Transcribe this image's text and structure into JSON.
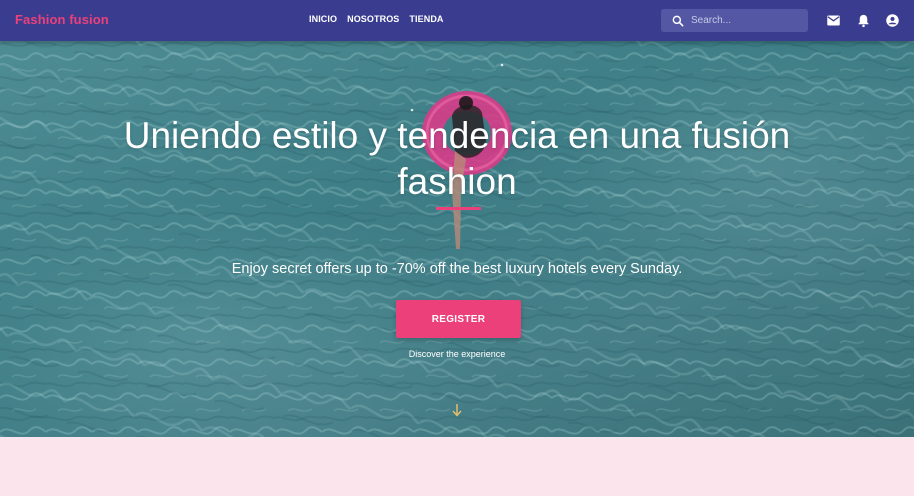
{
  "brand": "Fashion fusion",
  "nav": {
    "items": [
      "INICIO",
      "NOSOTROS",
      "TIENDA"
    ]
  },
  "search": {
    "placeholder": "Search..."
  },
  "header_icons": [
    "search-icon",
    "mail-icon",
    "bell-icon",
    "account-icon"
  ],
  "hero": {
    "title_line1": "Uniendo estilo y tendencia en una fusión",
    "title_line2": "fashion",
    "subtitle": "Enjoy secret offers up to -70% off the best luxury hotels every Sunday.",
    "cta_label": "REGISTER",
    "discover_label": "Discover the experience"
  },
  "colors": {
    "navbar": "#3a3d8f",
    "brand": "#ec407a",
    "accent": "#ec407a",
    "water": "#4a868d",
    "footer_bg": "#fce4ec"
  }
}
